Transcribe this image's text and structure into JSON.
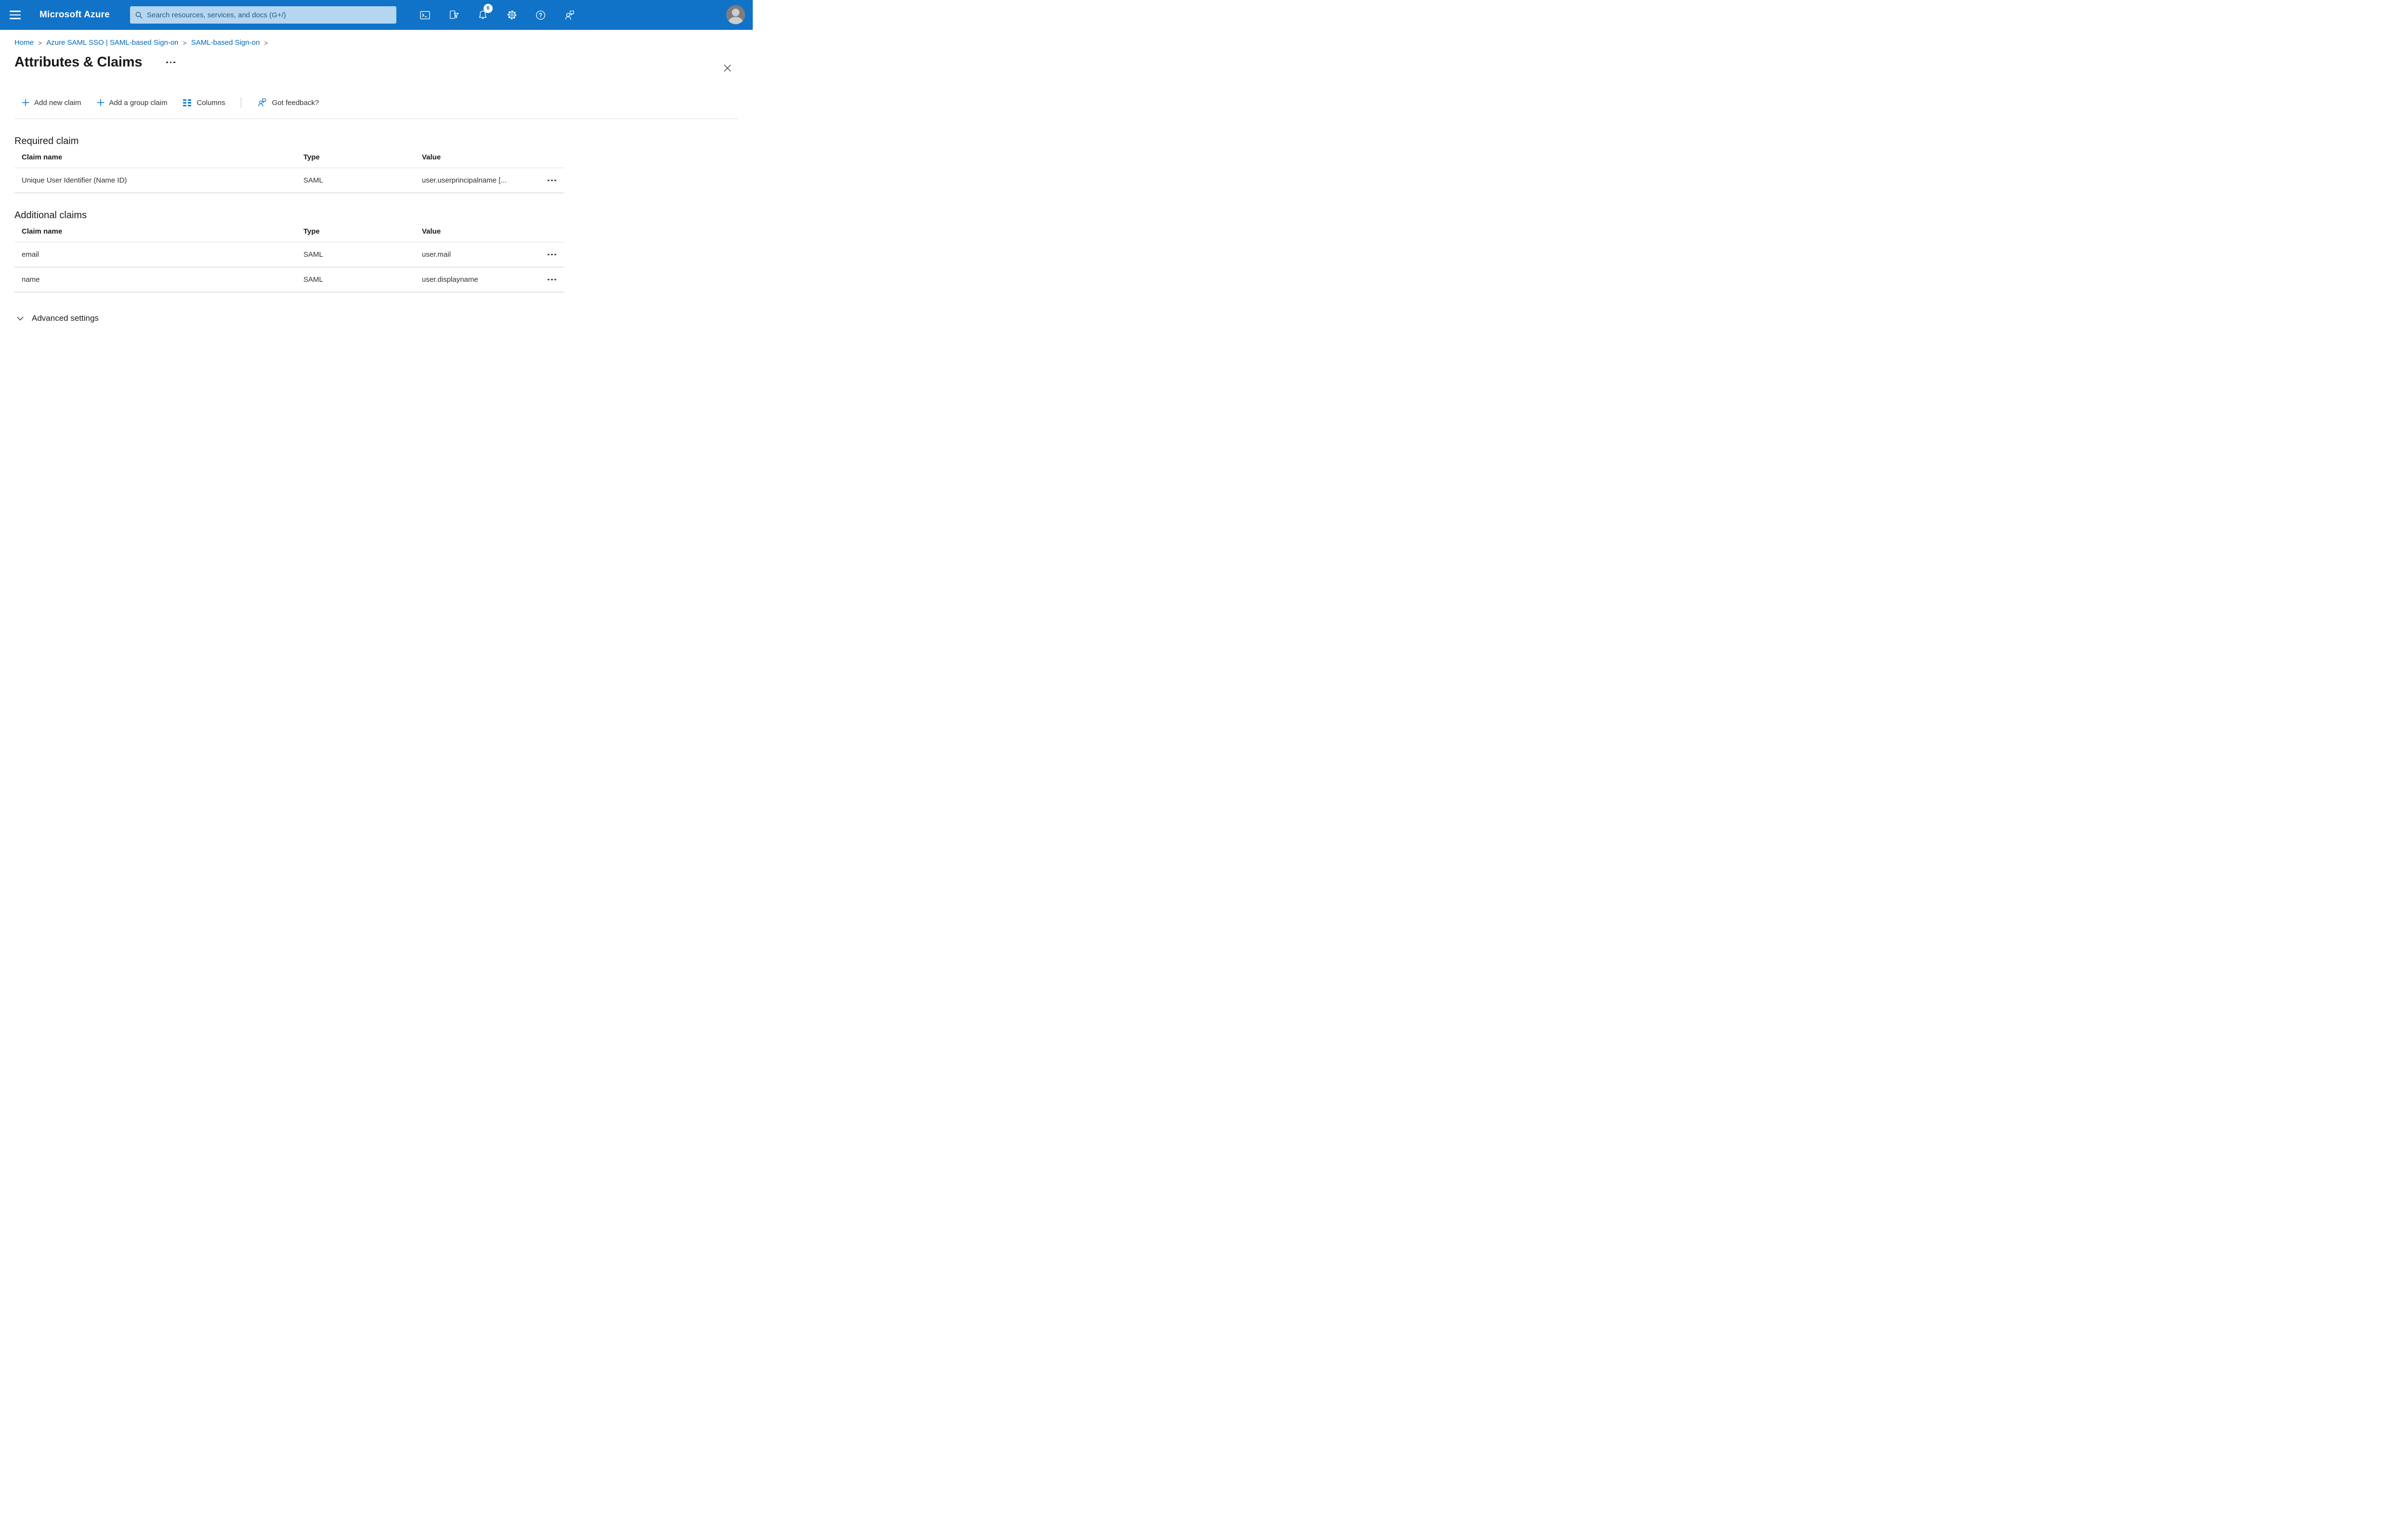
{
  "topbar": {
    "brand": "Microsoft Azure",
    "search_placeholder": "Search resources, services, and docs (G+/)",
    "notification_count": "6"
  },
  "breadcrumb": {
    "separator": ">",
    "items": [
      "Home",
      "Azure SAML SSO | SAML-based Sign-on",
      "SAML-based Sign-on"
    ]
  },
  "page": {
    "title": "Attributes & Claims"
  },
  "toolbar": {
    "add_new_claim": "Add new claim",
    "add_group_claim": "Add a group claim",
    "columns": "Columns",
    "got_feedback": "Got feedback?"
  },
  "required_claim": {
    "heading": "Required claim",
    "columns": [
      "Claim name",
      "Type",
      "Value"
    ],
    "rows": [
      {
        "claim_name": "Unique User Identifier (Name ID)",
        "type": "SAML",
        "value": "user.userprincipalname [..."
      }
    ]
  },
  "additional_claims": {
    "heading": "Additional claims",
    "columns": [
      "Claim name",
      "Type",
      "Value"
    ],
    "rows": [
      {
        "claim_name": "email",
        "type": "SAML",
        "value": "user.mail"
      },
      {
        "claim_name": "name",
        "type": "SAML",
        "value": "user.displayname"
      }
    ]
  },
  "advanced_settings": {
    "label": "Advanced settings"
  },
  "colors": {
    "topbar_bg": "#1073c8",
    "search_bg": "#b4d6f0",
    "search_text": "#2d557d",
    "link": "#0067b8",
    "accent": "#0078d4",
    "text_dark": "#1b1a19",
    "text_body": "#323130",
    "border_light": "#e1dfdd",
    "border_row": "#c8c6c4"
  }
}
